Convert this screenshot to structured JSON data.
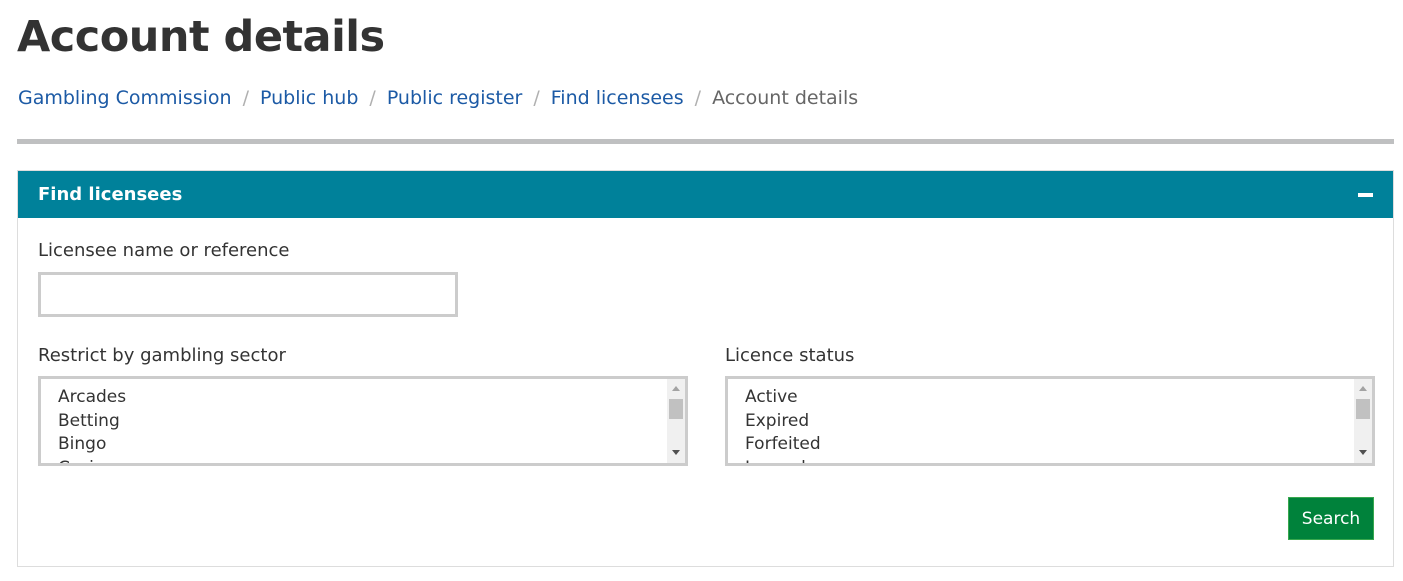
{
  "page": {
    "title": "Account details"
  },
  "breadcrumb": {
    "items": [
      {
        "label": "Gambling Commission"
      },
      {
        "label": "Public hub"
      },
      {
        "label": "Public register"
      },
      {
        "label": "Find licensees"
      }
    ],
    "current": "Account details",
    "separator": "/"
  },
  "panel": {
    "title": "Find licensees",
    "collapse_icon": "minus-icon",
    "name_field": {
      "label": "Licensee name or reference",
      "value": "",
      "placeholder": ""
    },
    "sector": {
      "label": "Restrict by gambling sector",
      "options": [
        "Arcades",
        "Betting",
        "Bingo",
        "Casino"
      ]
    },
    "status": {
      "label": "Licence status",
      "options": [
        "Active",
        "Expired",
        "Forfeited",
        "Lapsed"
      ]
    },
    "search_label": "Search"
  },
  "colors": {
    "panel_header": "#00819a",
    "link": "#1c5aa5",
    "search_button": "#00823b"
  }
}
